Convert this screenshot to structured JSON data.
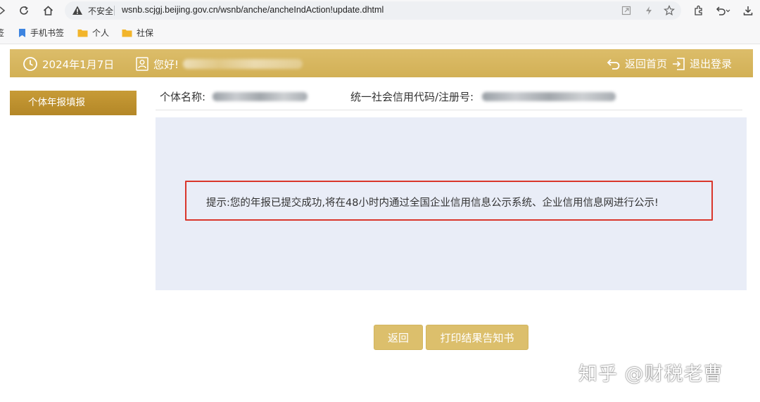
{
  "browser": {
    "insecure_label": "不安全",
    "url": "wsnb.scjgj.beijing.gov.cn/wsnb/anche/ancheIndAction!update.dhtml",
    "bookmarks": [
      {
        "label": "签",
        "icon": "bookmark-folder-icon"
      },
      {
        "label": "手机书签",
        "icon": "mobile-bookmark-icon"
      },
      {
        "label": "个人",
        "icon": "folder-icon"
      },
      {
        "label": "社保",
        "icon": "folder-icon"
      }
    ]
  },
  "header": {
    "date": "2024年1月7日",
    "greeting": "您好!",
    "home_link": "返回首页",
    "logout_link": "退出登录"
  },
  "sidebar": {
    "items": [
      {
        "label": "个体年报填报"
      }
    ]
  },
  "info": {
    "name_label": "个体名称:",
    "code_label": "统一社会信用代码/注册号:"
  },
  "notice": {
    "text": "提示:您的年报已提交成功,将在48小时内通过全国企业信用信息公示系统、企业信用信息网进行公示!"
  },
  "buttons": {
    "back": "返回",
    "print": "打印结果告知书"
  },
  "watermark": "知乎 @财税老曹",
  "colors": {
    "header_gold": "#d8b863",
    "sidebar_gold": "#b48727",
    "button_gold": "#dcbf6c",
    "panel_bg": "#e9edf7",
    "notice_border": "#d9362b"
  }
}
